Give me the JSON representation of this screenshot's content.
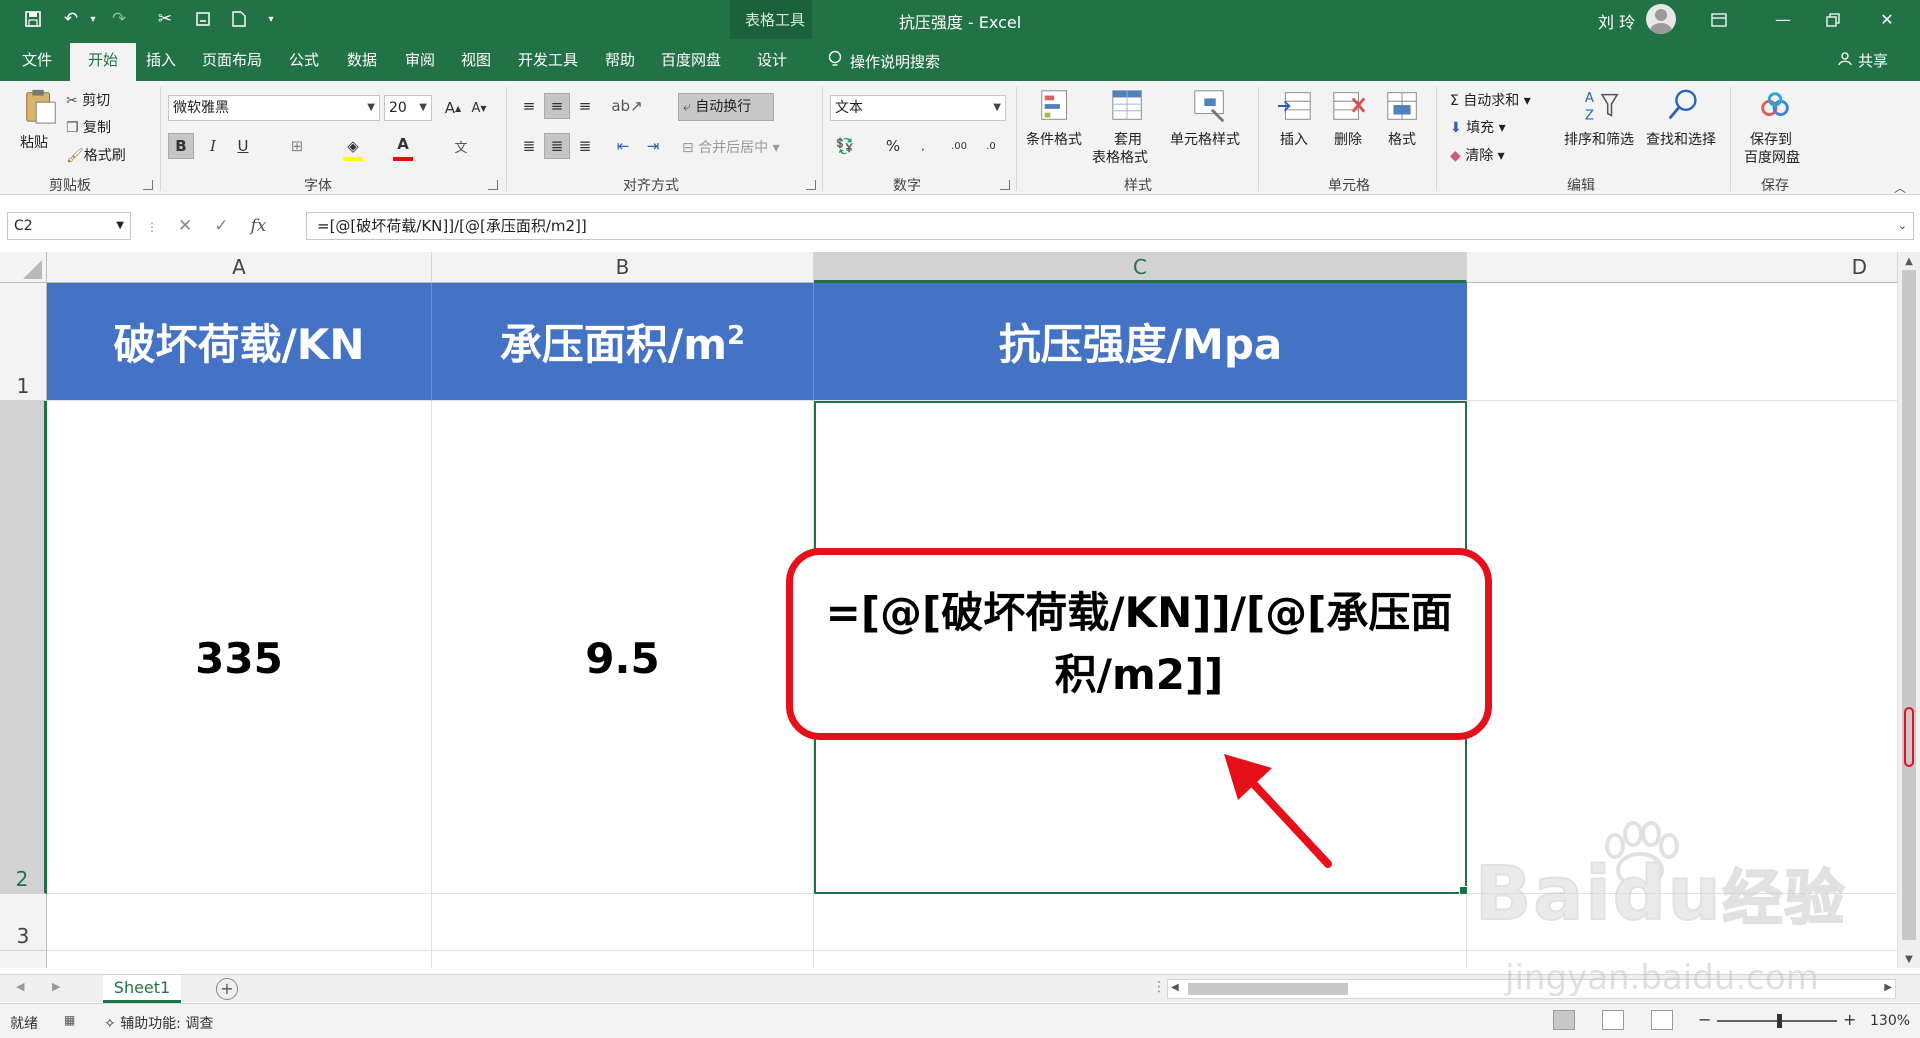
{
  "window": {
    "title": "抗压强度 - Excel",
    "contextual_tab": "表格工具",
    "user": "刘 玲"
  },
  "tabs": [
    "文件",
    "开始",
    "插入",
    "页面布局",
    "公式",
    "数据",
    "审阅",
    "视图",
    "开发工具",
    "帮助",
    "百度网盘",
    "设计"
  ],
  "active_tab": "开始",
  "tell_me": "操作说明搜索",
  "share": "共享",
  "ribbon": {
    "clipboard": {
      "paste": "粘贴",
      "cut": "剪切",
      "copy": "复制",
      "format_painter": "格式刷",
      "label": "剪贴板"
    },
    "font": {
      "name": "微软雅黑",
      "size": "20",
      "label": "字体",
      "bold": "B",
      "italic": "I",
      "underline": "U",
      "font_color": "A",
      "color_bar": "#ff0000",
      "fill_bar": "#ffff00"
    },
    "alignment": {
      "wrap": "自动换行",
      "merge": "合并后居中",
      "label": "对齐方式"
    },
    "number": {
      "format": "文本",
      "percent": "%",
      "label": "数字"
    },
    "styles": {
      "conditional": "条件格式",
      "table_line1": "套用",
      "table_line2": "表格格式",
      "cell_styles": "单元格样式",
      "label": "样式"
    },
    "cells": {
      "insert": "插入",
      "delete": "删除",
      "format": "格式",
      "label": "单元格"
    },
    "editing": {
      "autosum": "自动求和",
      "fill": "填充",
      "clear": "清除",
      "sort": "排序和筛选",
      "find": "查找和选择",
      "label": "编辑"
    },
    "save": {
      "line1": "保存到",
      "line2": "百度网盘",
      "label": "保存"
    }
  },
  "formula_bar": {
    "name_box": "C2",
    "cancel": "✕",
    "enter": "✓",
    "fx": "fx",
    "formula": "=[@[破坏荷载/KN]]/[@[承压面积/m2]]"
  },
  "sheet": {
    "columns": [
      "A",
      "B",
      "C",
      "D"
    ],
    "selected_column": "C",
    "rows": [
      "1",
      "2",
      "3"
    ],
    "selected_row": "2",
    "header_fill": "#4472c4",
    "headers": {
      "a": "破坏荷载/KN",
      "b_base": "承压面积/m",
      "b_sup": "2",
      "c": "抗压强度/Mpa"
    },
    "row2": {
      "a": "335",
      "b": "9.5"
    },
    "c2_callout": "=[@[破坏荷载/KN]]/[@[承压面积/m2]]",
    "callout_color": "#e6101a"
  },
  "sheet_tabs": [
    "Sheet1"
  ],
  "status": {
    "ready": "就绪",
    "accessibility": "辅助功能: 调查",
    "zoom": "130%"
  },
  "watermark": {
    "brand": "Bai",
    "brand2": "du",
    "brand_cn": "经验",
    "url": "jingyan.baidu.com"
  }
}
